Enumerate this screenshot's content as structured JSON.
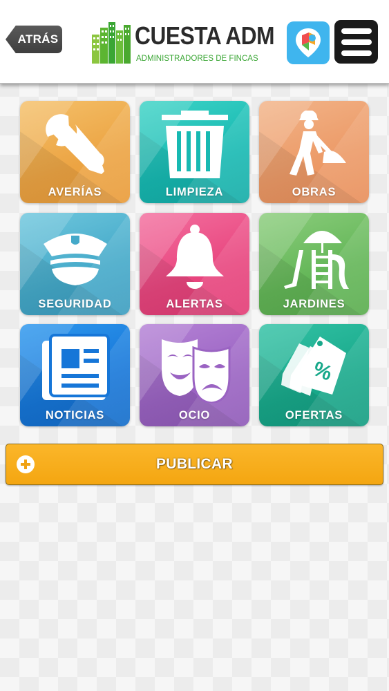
{
  "header": {
    "back_label": "ATRÁS",
    "logo_title": "CUESTA ADM",
    "logo_subtitle": "ADMINISTRADORES DE FINCAS",
    "map_icon": "map-pin-icon",
    "menu_icon": "hamburger-menu-icon"
  },
  "tiles": [
    {
      "label": "AVERÍAS",
      "icon": "tools-icon",
      "color": "#eca443"
    },
    {
      "label": "LIMPIEZA",
      "icon": "trash-can-icon",
      "color": "#17b9b2"
    },
    {
      "label": "OBRAS",
      "icon": "construction-worker-icon",
      "color": "#ec9a67"
    },
    {
      "label": "SEGURIDAD",
      "icon": "police-cap-icon",
      "color": "#44a9c9"
    },
    {
      "label": "ALERTAS",
      "icon": "bell-icon",
      "color": "#e8457e"
    },
    {
      "label": "JARDINES",
      "icon": "playground-icon",
      "color": "#63b657"
    },
    {
      "label": "NOTICIAS",
      "icon": "newspaper-icon",
      "color": "#1676d8"
    },
    {
      "label": "OCIO",
      "icon": "theater-masks-icon",
      "color": "#9a63c2"
    },
    {
      "label": "OFERTAS",
      "icon": "price-tag-icon",
      "color": "#18a88a"
    }
  ],
  "publish": {
    "label": "PUBLICAR",
    "icon": "plus-circle-icon",
    "color": "#f4a611"
  }
}
